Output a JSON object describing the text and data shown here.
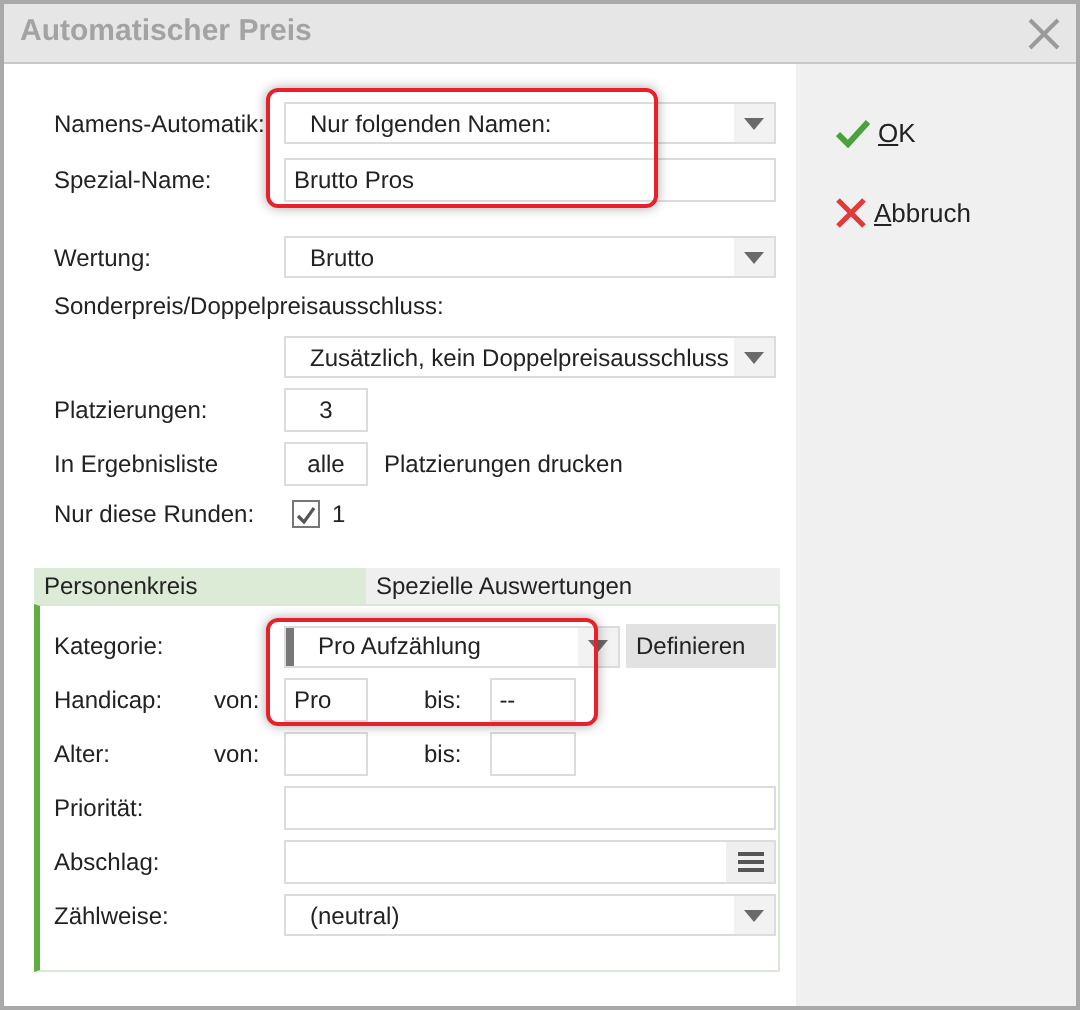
{
  "window": {
    "title": "Automatischer Preis"
  },
  "sections": [
    [
      {
        "kind": "select",
        "label": "Namens-Automatik:",
        "value": "Nur folgenden Namen:"
      },
      {
        "kind": "input",
        "label": "Spezial-Name:",
        "value": "Brutto Pros"
      }
    ],
    [
      {
        "kind": "select",
        "label": "Wertung:",
        "value": "Brutto"
      },
      {
        "kind": "label_select",
        "label": "Sonderpreis/Doppelpreisausschluss:",
        "value": "Zusätzlich, kein Doppelpreisausschluss"
      },
      {
        "kind": "short_input",
        "label": "Platzierungen:",
        "value": "3"
      },
      {
        "kind": "short_input",
        "label": "In Ergebnisliste",
        "value": "alle",
        "suffix": "Platzierungen drucken"
      },
      {
        "kind": "checkbox",
        "label": "Nur diese Runden:",
        "checked": true,
        "text": "1"
      }
    ]
  ],
  "tabs": [
    {
      "label": "Personenkreis",
      "selected": true
    },
    {
      "label": "Spezielle Auswertungen",
      "selected": false
    }
  ],
  "tab_fields": [
    {
      "kind": "select_button",
      "label": "Kategorie:",
      "value": "Pro Aufzählung",
      "button": "Definieren"
    },
    {
      "kind": "range",
      "label": "Handicap:",
      "from_label": "von:",
      "from": "Pro",
      "to_label": "bis:",
      "to": "--"
    },
    {
      "kind": "range",
      "label": "Alter:",
      "from_label": "von:",
      "to_label": "bis:"
    },
    {
      "kind": "input",
      "label": "Priorität:"
    },
    {
      "kind": "input_menu",
      "label": "Abschlag:"
    },
    {
      "kind": "select",
      "label": "Zählweise:",
      "value": "(neutral)"
    }
  ],
  "buttons": [
    {
      "kind": "ok",
      "label": "OK"
    },
    {
      "kind": "cancel",
      "label": "Abbruch"
    }
  ]
}
